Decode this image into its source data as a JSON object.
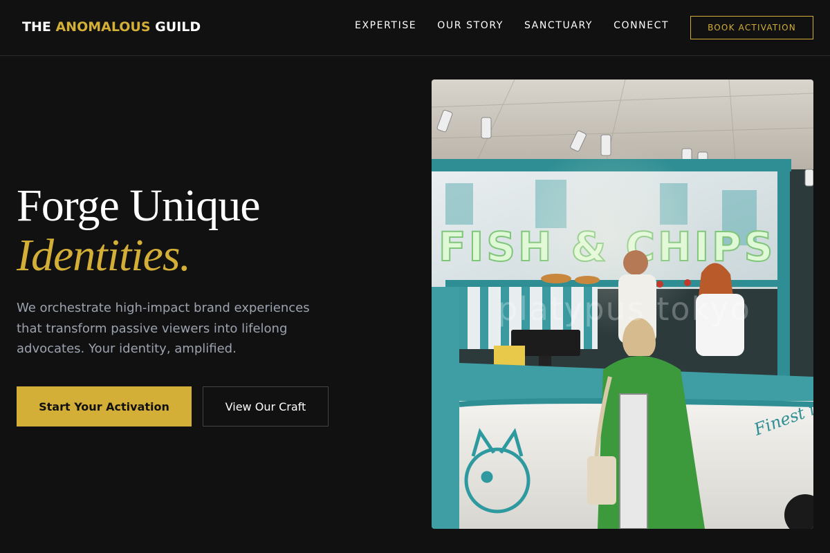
{
  "brand": {
    "prefix": "THE",
    "accent": "ANOMALOUS",
    "suffix": "GUILD"
  },
  "nav": {
    "items": [
      {
        "label": "EXPERTISE"
      },
      {
        "label": "OUR STORY"
      },
      {
        "label": "SANCTUARY"
      },
      {
        "label": "CONNECT"
      }
    ],
    "cta_label": "BOOK ACTIVATION"
  },
  "hero": {
    "title_line1": "Forge Unique",
    "title_line2": "Identities.",
    "description": "We orchestrate high-impact brand experiences that transform passive viewers into lifelong advocates. Your identity, amplified.",
    "primary_button": "Start Your Activation",
    "secondary_button": "View Our Craft"
  },
  "image": {
    "sign_text": "FISH & CHIPS",
    "watermark": "platypus tokyo",
    "icon": "storefront-photo"
  },
  "colors": {
    "background": "#111111",
    "accent": "#d4af37",
    "muted_text": "#9ca3af"
  }
}
